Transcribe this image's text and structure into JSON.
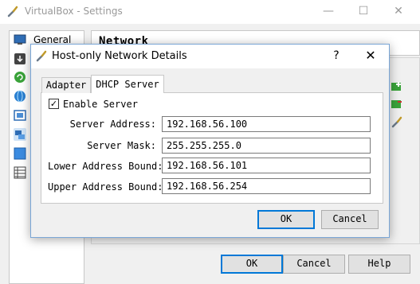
{
  "main_window": {
    "title": "VirtualBox - Settings",
    "minimize_glyph": "—",
    "maximize_glyph": "☐",
    "close_glyph": "✕",
    "sidebar": {
      "general_label": "General"
    },
    "section_title": "Network",
    "buttons": {
      "ok": "OK",
      "cancel": "Cancel",
      "help": "Help"
    }
  },
  "dialog": {
    "title": "Host-only Network Details",
    "help_glyph": "?",
    "close_glyph": "✕",
    "tabs": [
      {
        "label": "Adapter",
        "selected": false
      },
      {
        "label": "DHCP Server",
        "selected": true
      }
    ],
    "enable_server": {
      "label": "Enable Server",
      "checked": true,
      "check_glyph": "✓"
    },
    "fields": {
      "server_address": {
        "label": "Server Address:",
        "value": "192.168.56.100"
      },
      "server_mask": {
        "label": "Server Mask:",
        "value": "255.255.255.0"
      },
      "lower_bound": {
        "label": "Lower Address Bound:",
        "value": "192.168.56.101"
      },
      "upper_bound": {
        "label": "Upper Address Bound:",
        "value": "192.168.56.254"
      }
    },
    "buttons": {
      "ok": "OK",
      "cancel": "Cancel"
    }
  },
  "colors": {
    "accent": "#0078d7",
    "dialog_border": "#7aa6d6",
    "window_bg": "#f0f0f0"
  }
}
